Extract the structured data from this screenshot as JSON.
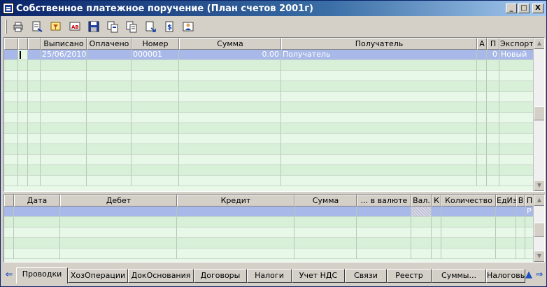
{
  "window": {
    "title": "Собственное платежное поручение (План счетов 2001г)",
    "btn_minimize": "_",
    "btn_maximize": "□",
    "btn_close": "X"
  },
  "toolbar": {
    "buttons": [
      "print-icon",
      "edit-doc-icon",
      "filter-icon",
      "ab-icon",
      "save-icon",
      "copy-icon",
      "list-icon",
      "doc-arrow-icon",
      "dollar-doc-icon",
      "user-card-icon"
    ]
  },
  "upper_grid": {
    "columns": [
      "",
      "",
      "",
      "Выписано",
      "Оплачено",
      "Номер",
      "Сумма",
      "Получатель",
      "А",
      "П",
      "Экспорт"
    ],
    "rows": [
      {
        "issued": "25/06/2010",
        "paid": "",
        "number": "000001",
        "amount": "0.00",
        "recipient": "Получатель",
        "a": "",
        "p": "0",
        "export": "Новый"
      }
    ]
  },
  "lower_grid": {
    "columns": [
      "",
      "Дата",
      "Дебет",
      "Кредит",
      "Сумма",
      "... в валюте",
      "Вал.",
      "К",
      "Количество",
      "ЕдИз",
      "В",
      "П"
    ],
    "rows": [
      {
        "date": "",
        "debit": "",
        "credit": "",
        "amount": "",
        "currency_amount": "",
        "currency": "",
        "k": "",
        "quantity": "",
        "unit": "",
        "v": "",
        "p": "Р"
      }
    ]
  },
  "tabs": [
    "Проводки",
    "ХозОперации",
    "ДокОснования",
    "Договоры",
    "Налоги",
    "Учет НДС",
    "Связи",
    "Реестр",
    "Суммы...",
    "Налоговы"
  ],
  "active_tab": "Проводки"
}
